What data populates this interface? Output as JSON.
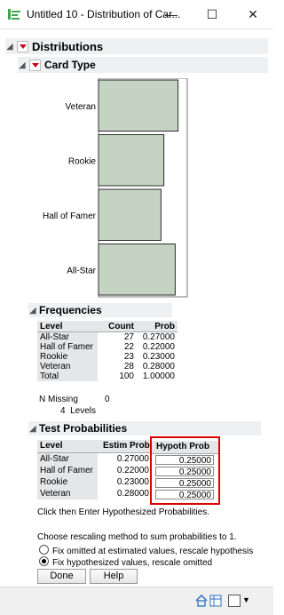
{
  "window": {
    "title": "Untitled 10 - Distribution of Car...",
    "minimize": "—",
    "maximize": "☐",
    "close": "✕"
  },
  "distributions": {
    "title": "Distributions",
    "section_title": "Card Type",
    "chart_data": {
      "type": "bar",
      "orientation": "horizontal",
      "categories": [
        "Veteran",
        "Rookie",
        "Hall of Famer",
        "All-Star"
      ],
      "values": [
        0.28,
        0.23,
        0.22,
        0.27
      ]
    }
  },
  "frequencies": {
    "title": "Frequencies",
    "headers": [
      "Level",
      "Count",
      "Prob"
    ],
    "rows": [
      [
        "All-Star",
        "27",
        "0.27000"
      ],
      [
        "Hall of Famer",
        "22",
        "0.22000"
      ],
      [
        "Rookie",
        "23",
        "0.23000"
      ],
      [
        "Veteran",
        "28",
        "0.28000"
      ],
      [
        "Total",
        "100",
        "1.00000"
      ]
    ],
    "n_missing_label": "N Missing",
    "n_missing_value": "0",
    "levels_label": "4  Levels"
  },
  "test_probabilities": {
    "title": "Test Probabilities",
    "headers": [
      "Level",
      "Estim Prob",
      "Hypoth Prob"
    ],
    "rows": [
      [
        "All-Star",
        "0.27000",
        "0.25000"
      ],
      [
        "Hall of Famer",
        "0.22000",
        "0.25000"
      ],
      [
        "Rookie",
        "0.23000",
        "0.25000"
      ],
      [
        "Veteran",
        "0.28000",
        "0.25000"
      ]
    ],
    "instruction": "Click then Enter Hypothesized Probabilities.",
    "rescale_prompt": "Choose rescaling method to sum probabilities to 1.",
    "radio_options": [
      {
        "label": "Fix omitted at estimated values, rescale hypothesis",
        "selected": false
      },
      {
        "label": "Fix hypothesized values, rescale omitted",
        "selected": true
      }
    ],
    "done_button": "Done",
    "help_button": "Help"
  },
  "colors": {
    "bar_fill": "#c4d3c2",
    "highlight": "#dd0000",
    "menu_triangle": "#d0021b"
  }
}
